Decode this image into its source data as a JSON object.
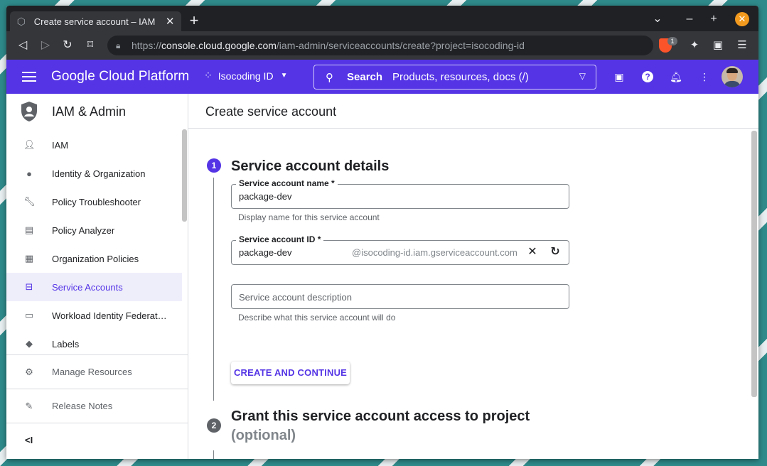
{
  "browser": {
    "tab_title": "Create service account – IAM",
    "url_prefix": "https://",
    "url_host": "console.cloud.google.com",
    "url_path": "/iam-admin/serviceaccounts/create?project=isocoding-id",
    "brave_badge": "1"
  },
  "header": {
    "brand": "Google Cloud Platform",
    "project": "Isocoding ID",
    "search_label": "Search",
    "search_placeholder": "Products, resources, docs (/)"
  },
  "sidebar": {
    "title": "IAM & Admin",
    "items": [
      {
        "label": "IAM",
        "icon": "person-add-icon"
      },
      {
        "label": "Identity & Organization",
        "icon": "account-circle-icon"
      },
      {
        "label": "Policy Troubleshooter",
        "icon": "wrench-icon"
      },
      {
        "label": "Policy Analyzer",
        "icon": "document-search-icon"
      },
      {
        "label": "Organization Policies",
        "icon": "list-document-icon"
      },
      {
        "label": "Service Accounts",
        "icon": "service-account-icon",
        "active": true
      },
      {
        "label": "Workload Identity Federat…",
        "icon": "id-card-icon"
      },
      {
        "label": "Labels",
        "icon": "tag-icon"
      }
    ],
    "bottom": [
      {
        "label": "Manage Resources",
        "icon": "settings-folder-icon"
      },
      {
        "label": "Release Notes",
        "icon": "release-notes-icon"
      }
    ],
    "collapse_label": "<I"
  },
  "main": {
    "page_title": "Create service account",
    "step1": {
      "number": "1",
      "title": "Service account details",
      "name_field": {
        "label": "Service account name *",
        "value": "package-dev",
        "hint": "Display name for this service account"
      },
      "id_field": {
        "label": "Service account ID *",
        "value": "package-dev",
        "suffix": "@isocoding-id.iam.gserviceaccount.com"
      },
      "description_field": {
        "placeholder": "Service account description",
        "hint": "Describe what this service account will do"
      },
      "create_button": "CREATE AND CONTINUE"
    },
    "step2": {
      "number": "2",
      "title": "Grant this service account access to project",
      "subtitle": "(optional)"
    }
  },
  "colors": {
    "accent": "#5434e5",
    "step_inactive": "#5f6368"
  }
}
